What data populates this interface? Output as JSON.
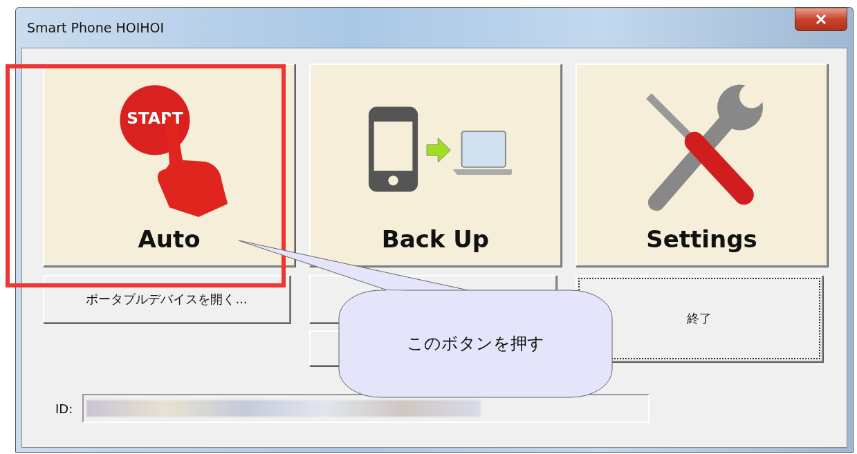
{
  "window": {
    "title": "Smart Phone HOIHOI"
  },
  "big_buttons": [
    {
      "label": "Auto",
      "kind": "start",
      "icon_text": "START"
    },
    {
      "label": "Back Up",
      "kind": "backup"
    },
    {
      "label": "Settings",
      "kind": "settings"
    }
  ],
  "open_device_button": {
    "label": "ポータブルデバイスを開く..."
  },
  "exit_button": {
    "label": "終了",
    "focused": true
  },
  "id_field": {
    "label": "ID:"
  },
  "callout": {
    "text": "このボタンを押す"
  }
}
